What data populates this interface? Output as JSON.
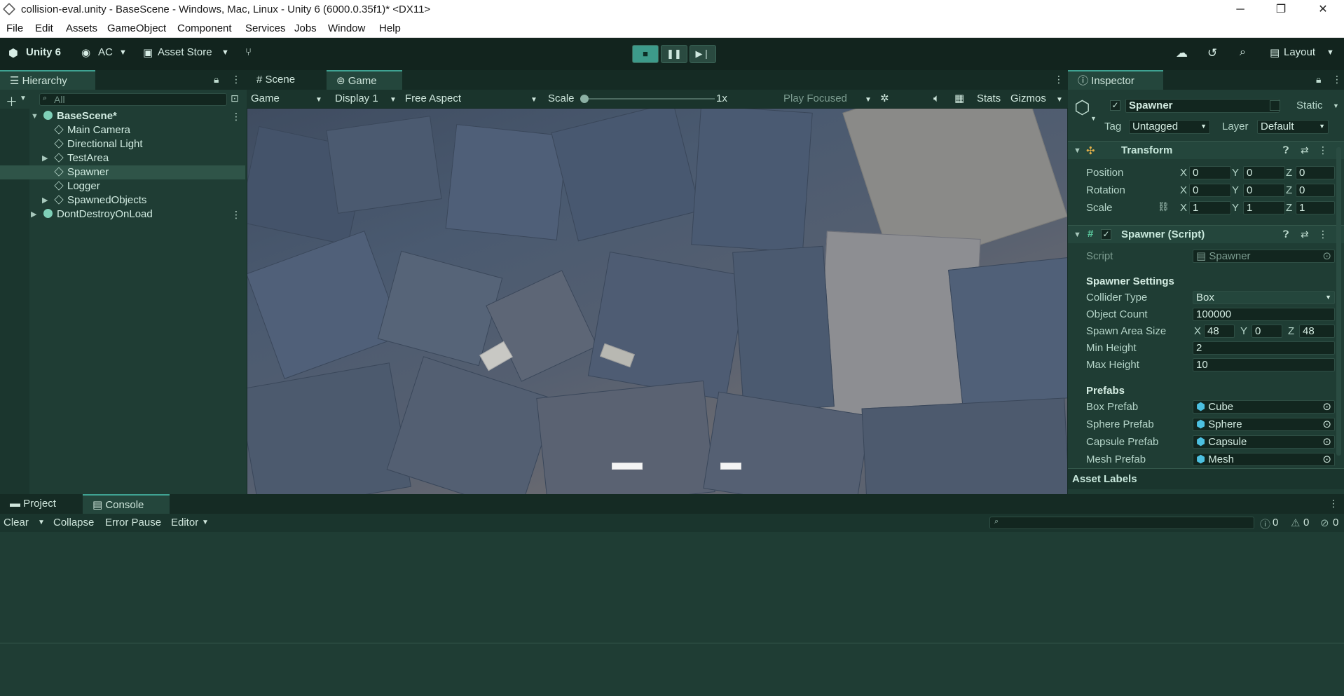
{
  "window": {
    "title": "collision-eval.unity - BaseScene - Windows, Mac, Linux - Unity 6 (6000.0.35f1)* <DX11>",
    "minimize": "─",
    "maximize": "❐",
    "close": "✕"
  },
  "menu": [
    "File",
    "Edit",
    "Assets",
    "GameObject",
    "Component",
    "Services",
    "Jobs",
    "Window",
    "Help"
  ],
  "toolbar": {
    "unity_label": "Unity 6",
    "account": "AC",
    "asset_store": "Asset Store",
    "layout": "Layout",
    "stop": "■",
    "pause": "❚❚",
    "step": "▶❘"
  },
  "hierarchy": {
    "tab": "Hierarchy",
    "search_placeholder": "All",
    "items": [
      {
        "label": "BaseScene*"
      },
      {
        "label": "Main Camera"
      },
      {
        "label": "Directional Light"
      },
      {
        "label": "TestArea"
      },
      {
        "label": "Spawner"
      },
      {
        "label": "Logger"
      },
      {
        "label": "SpawnedObjects"
      },
      {
        "label": "DontDestroyOnLoad"
      }
    ]
  },
  "center_tabs": {
    "scene": "Scene",
    "game": "Game"
  },
  "game_bar": {
    "display_mode": "Game",
    "display": "Display 1",
    "aspect": "Free Aspect",
    "scale_label": "Scale",
    "scale_value": "1x",
    "play_mode": "Play Focused",
    "stats": "Stats",
    "gizmos": "Gizmos"
  },
  "inspector": {
    "tab": "Inspector",
    "object_name": "Spawner",
    "static_label": "Static",
    "tag_label": "Tag",
    "tag_value": "Untagged",
    "layer_label": "Layer",
    "layer_value": "Default",
    "transform": {
      "title": "Transform",
      "position_label": "Position",
      "rotation_label": "Rotation",
      "scale_label": "Scale",
      "position": [
        "0",
        "0",
        "0"
      ],
      "rotation": [
        "0",
        "0",
        "0"
      ],
      "scale": [
        "1",
        "1",
        "1"
      ],
      "axes": [
        "X",
        "Y",
        "Z"
      ]
    },
    "script_comp": {
      "title": "Spawner (Script)",
      "script_label": "Script",
      "script_value": "Spawner",
      "settings_header": "Spawner Settings",
      "collider_type_label": "Collider Type",
      "collider_type": "Box",
      "object_count_label": "Object Count",
      "object_count": "100000",
      "spawn_area_label": "Spawn Area Size",
      "spawn_area": [
        "48",
        "0",
        "48"
      ],
      "min_height_label": "Min Height",
      "min_height": "2",
      "max_height_label": "Max Height",
      "max_height": "10",
      "prefabs_header": "Prefabs",
      "box_prefab_label": "Box Prefab",
      "box_prefab": "Cube",
      "sphere_prefab_label": "Sphere Prefab",
      "sphere_prefab": "Sphere",
      "capsule_prefab_label": "Capsule Prefab",
      "capsule_prefab": "Capsule",
      "mesh_prefab_label": "Mesh Prefab",
      "mesh_prefab": "Mesh"
    },
    "asset_labels": "Asset Labels"
  },
  "bottom": {
    "project_tab": "Project",
    "console_tab": "Console",
    "clear": "Clear",
    "collapse": "Collapse",
    "error_pause": "Error Pause",
    "editor": "Editor",
    "count_info": "0",
    "count_warn": "0",
    "count_error": "0"
  }
}
